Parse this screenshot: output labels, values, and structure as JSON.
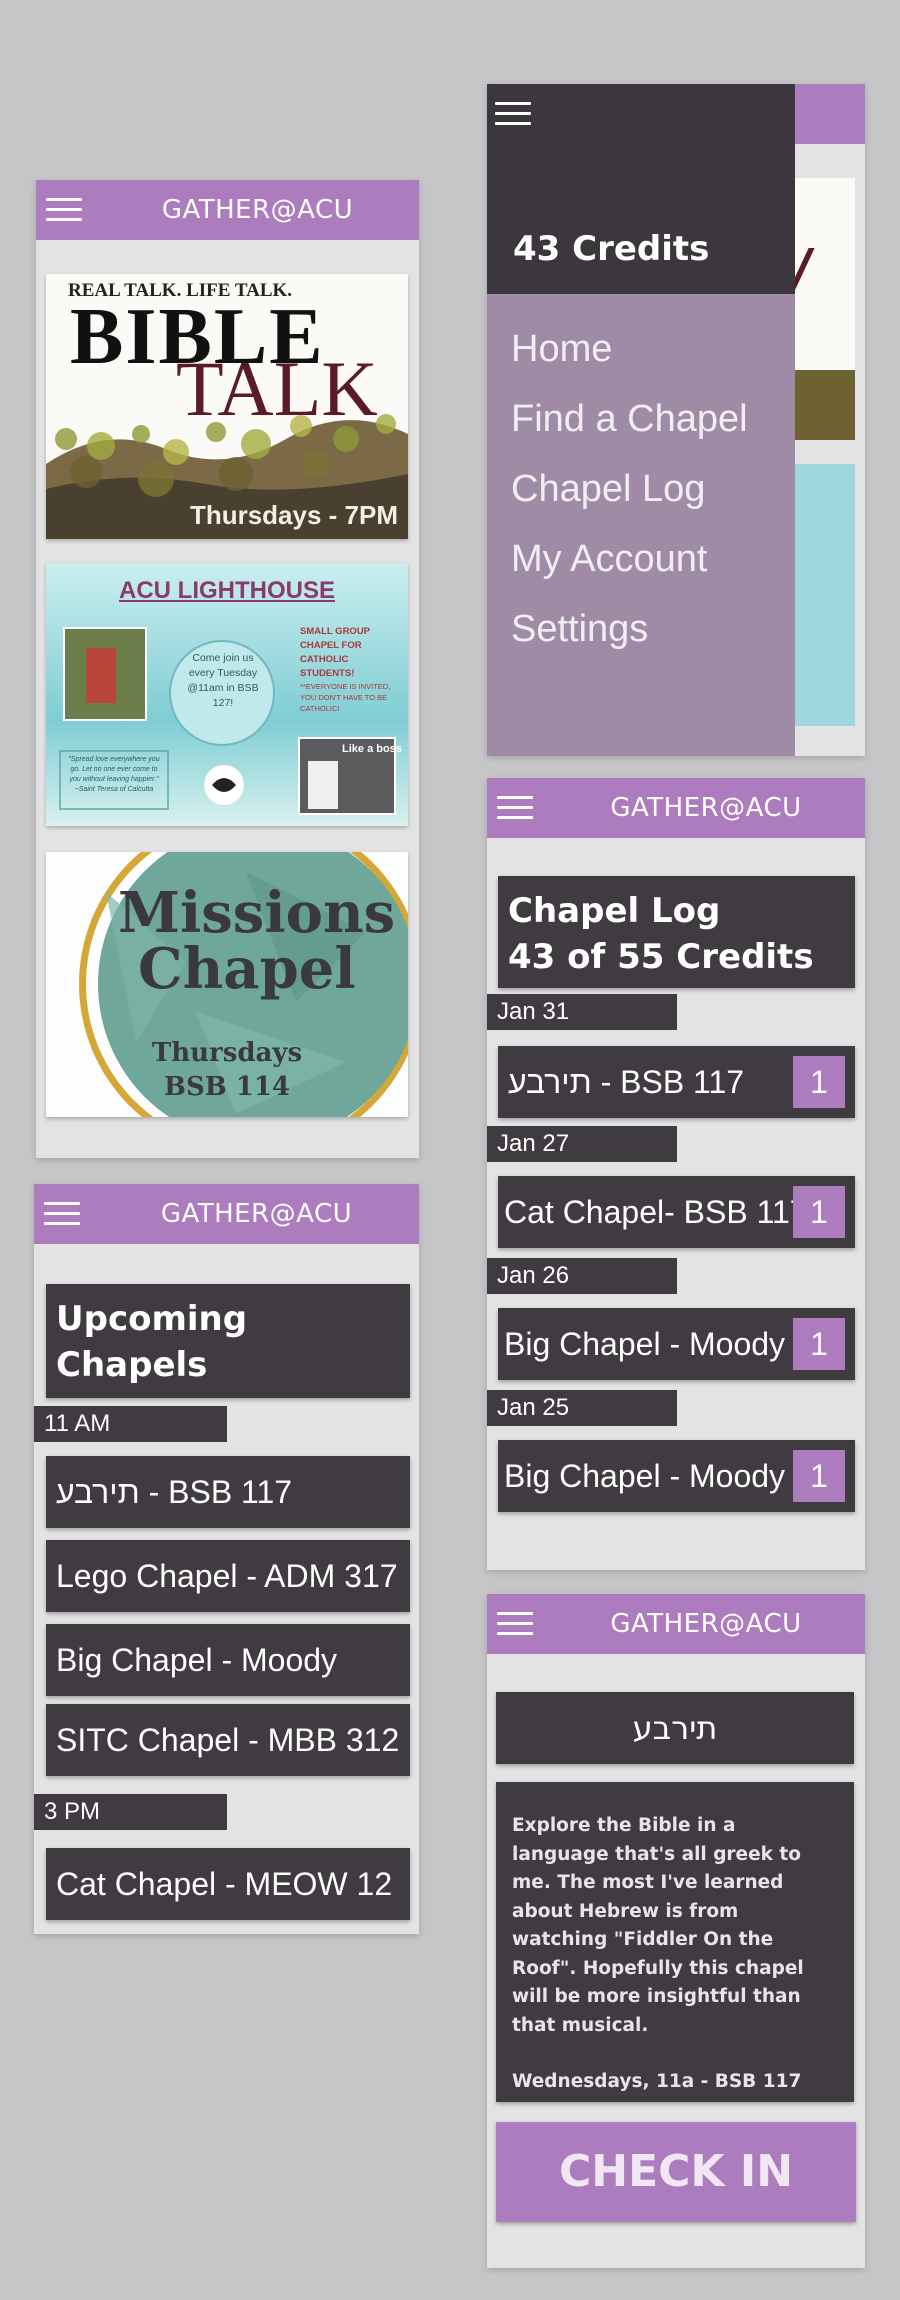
{
  "app_title": "GATHER@ACU",
  "colors": {
    "accent": "#ad7cbe",
    "dark": "#403a41",
    "panel": "#e3e3e4",
    "background": "#c6c6c8"
  },
  "icons": {
    "menu": "hamburger-menu-icon"
  },
  "home": {
    "banners": [
      {
        "name": "bible-talk",
        "top_text": "REAL TALK. LIFE TALK.",
        "title_1": "BIBLE",
        "title_2": "TALK",
        "footer": "Thursdays - 7PM"
      },
      {
        "name": "acu-lighthouse",
        "title": "ACU LIGHTHOUSE",
        "circle_text": "Come join us every Tuesday @11am in BSB 127!",
        "side_text": "SMALL GROUP CHAPEL FOR CATHOLIC STUDENTS!",
        "note": "**EVERYONE IS INVITED, YOU DON'T HAVE TO BE CATHOLIC!",
        "quote": "\"Spread love everywhere you go. Let no one ever come to you without leaving happier.\" ~Saint Teresa of Calcutta",
        "photo_caption": "Like a boss"
      },
      {
        "name": "missions-chapel",
        "title_1": "Missions",
        "title_2": "Chapel",
        "sub_1": "Thursdays",
        "sub_2": "BSB 114"
      }
    ]
  },
  "upcoming": {
    "heading_1": "Upcoming",
    "heading_2": "Chapels",
    "groups": [
      {
        "time": "11 AM",
        "items": [
          "תירבע - BSB 117",
          "Lego Chapel - ADM 317",
          "Big Chapel - Moody",
          "SITC Chapel - MBB 312"
        ]
      },
      {
        "time": "3 PM",
        "items": [
          "Cat Chapel - MEOW 12"
        ]
      }
    ]
  },
  "drawer": {
    "credits": "43 Credits",
    "menu": [
      "Home",
      "Find a Chapel",
      "Chapel Log",
      "My Account",
      "Settings"
    ]
  },
  "log": {
    "heading_1": "Chapel Log",
    "heading_2": "43 of 55 Credits",
    "entries": [
      {
        "date": "Jan 31",
        "name": "תירבע - BSB 117",
        "credits": "1"
      },
      {
        "date": "Jan 27",
        "name": "Cat Chapel- BSB 117",
        "credits": "1"
      },
      {
        "date": "Jan 26",
        "name": "Big Chapel - Moody",
        "credits": "1"
      },
      {
        "date": "Jan 25",
        "name": "Big Chapel - Moody",
        "credits": "1"
      }
    ]
  },
  "detail": {
    "title": "תירבע",
    "description": "Explore the Bible in a language that's all greek to me. The most I've learned about Hebrew is from watching \"Fiddler On the Roof\". Hopefully this chapel will be more insightful than that musical.",
    "schedule": "Wednesdays, 11a - BSB 117",
    "checkin_label": "CHECK IN"
  }
}
